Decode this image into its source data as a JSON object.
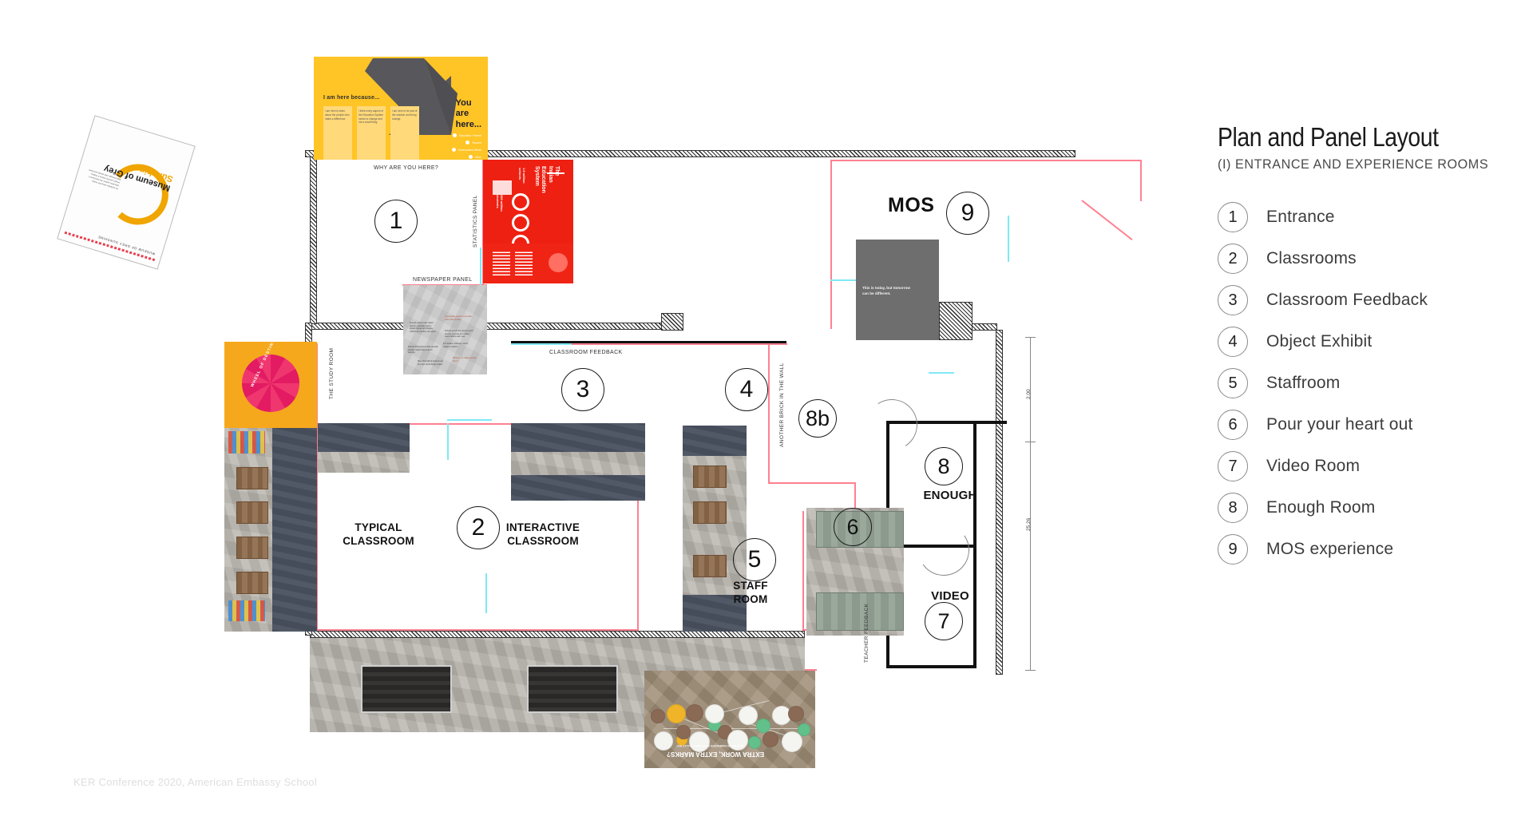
{
  "legend": {
    "title": "Plan and Panel Layout",
    "subtitle": "(I) ENTRANCE AND EXPERIENCE ROOMS",
    "items": [
      {
        "num": "1",
        "label": "Entrance"
      },
      {
        "num": "2",
        "label": "Classrooms"
      },
      {
        "num": "3",
        "label": "Classroom Feedback"
      },
      {
        "num": "4",
        "label": "Object Exhibit"
      },
      {
        "num": "5",
        "label": "Staffroom"
      },
      {
        "num": "6",
        "label": "Pour your heart out"
      },
      {
        "num": "7",
        "label": "Video Room"
      },
      {
        "num": "8",
        "label": "Enough Room"
      },
      {
        "num": "9",
        "label": "MOS experience"
      }
    ]
  },
  "footer": {
    "credit": "KER Conference 2020, American Embassy School"
  },
  "plan": {
    "markers": [
      {
        "id": "1",
        "note": "entrance"
      },
      {
        "id": "2",
        "note": "classrooms"
      },
      {
        "id": "3",
        "note": "classroom-feedback"
      },
      {
        "id": "4",
        "note": "object-exhibit"
      },
      {
        "id": "5",
        "note": "staff-room"
      },
      {
        "id": "6",
        "note": "pour-your-heart-out"
      },
      {
        "id": "7",
        "note": "video"
      },
      {
        "id": "8",
        "note": "enough"
      },
      {
        "id": "8b",
        "note": "enough-corridor"
      },
      {
        "id": "9",
        "note": "mos"
      }
    ],
    "room_labels": {
      "typical_classroom": "TYPICAL\nCLASSROOM",
      "interactive_classroom": "INTERACTIVE\nCLASSROOM",
      "staff_room": "STAFF\nROOM",
      "enough": "ENOUGH",
      "video": "VIDEO",
      "mos": "MOS"
    },
    "panel_captions": {
      "why_are_you_here": "WHY ARE YOU HERE?",
      "statistics_panel": "STATISTICS PANEL",
      "newspaper_panel": "NEWSPAPER PANEL",
      "classroom_feedback": "CLASSROOM FEEDBACK",
      "another_brick": "ANOTHER BRICK IN THE WALL",
      "teacher_feedback": "TEACHER FEEDBACK",
      "wheel_of_destiny": "WHEEL OF DESTINY"
    },
    "dimensions": {
      "small": "2.00",
      "large": "25.26"
    }
  },
  "panels": {
    "yellow": {
      "heading": "I am here because...",
      "you_are_here": "You\nare\nhere...",
      "columns": [
        "I am here to learn about the people who make a difference.",
        "I think every aspect of the Education System needs to change and not a small thing.",
        "I am here to be part of the solution and bring change."
      ],
      "bullets": [
        "Education / Parent",
        "Student",
        "Government official",
        "Other"
      ]
    },
    "red": {
      "title": "The Indian\nEducation System",
      "sub_left": "1.5 million\nschools",
      "sub_right": "260 million\nstudents",
      "caption": "STATISTICS PANEL"
    },
    "mos": {
      "quote": "This is today, but tomorrow\ncan be different."
    },
    "museum_of_grey_sunshine": {
      "header": "MUSEUM OF GREY SUNSHINE",
      "title_line1": "Museum of Grey",
      "title_line2": "Sunshine"
    },
    "market": {
      "title": "EXTRA WORK, EXTRA MARKS?",
      "subtitle": "HOW MUCH HOMEWORK DOES INDIA REALLY DO?"
    }
  },
  "colors": {
    "yellow": "#ffc425",
    "red": "#ee2012",
    "orange": "#f6a81c",
    "pink_line": "#ff8090",
    "cyan_line": "#7fe9f5",
    "gray_panel": "#6e6e6e",
    "ink": "#111111"
  }
}
